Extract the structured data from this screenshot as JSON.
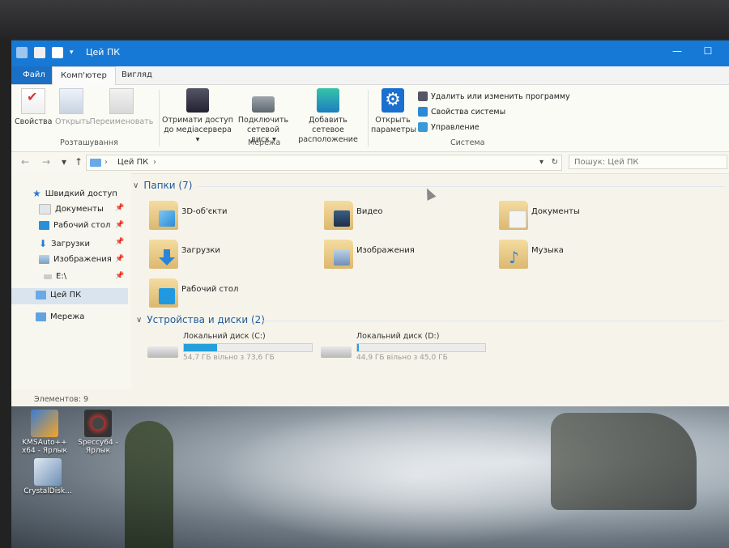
{
  "window": {
    "title": "Цей ПК",
    "minimize_glyph": "—",
    "maximize_glyph": "☐"
  },
  "tabs": [
    {
      "label": "Файл"
    },
    {
      "label": "Комп'ютер"
    },
    {
      "label": "Вигляд"
    }
  ],
  "ribbon": {
    "location": {
      "properties": "Свойства",
      "open": "Открыть",
      "rename": "Переименовать",
      "group_label": "Розташування"
    },
    "network": {
      "media_l1": "Отримати доступ",
      "media_l2": "до медіасервера ▾",
      "map_l1": "Подключить",
      "map_l2": "сетевой диск ▾",
      "add_l1": "Добавить сетевое",
      "add_l2": "расположение",
      "group_label": "Мережа"
    },
    "system": {
      "settings_l1": "Открыть",
      "settings_l2": "параметры",
      "uninstall": "Удалить или изменить программу",
      "sysprops": "Свойства системы",
      "manage": "Управление",
      "group_label": "Система"
    }
  },
  "address": {
    "back": "←",
    "forward": "→",
    "up": "↑",
    "path": "Цей ПК",
    "separator": "›",
    "search_placeholder": "Пошук: Цей ПК"
  },
  "nav": {
    "quick_access": "Швидкий доступ",
    "items": [
      {
        "label": "Документы"
      },
      {
        "label": "Рабочий стол"
      },
      {
        "label": "Загрузки"
      },
      {
        "label": "Изображения"
      },
      {
        "label": "E:\\"
      }
    ],
    "this_pc": "Цей ПК",
    "network": "Мережа"
  },
  "folders_group": "Папки (7)",
  "folders": [
    {
      "name": "3D-об'єкти"
    },
    {
      "name": "Видео"
    },
    {
      "name": "Документы"
    },
    {
      "name": "Загрузки"
    },
    {
      "name": "Изображения"
    },
    {
      "name": "Музыка"
    },
    {
      "name": "Рабочий стол"
    }
  ],
  "drives_group": "Устройства и диски (2)",
  "drives": [
    {
      "name": "Локальний диск (C:)",
      "free": "54,7 ГБ вільно з 73,6 ГБ",
      "used_fraction": 0.26
    },
    {
      "name": "Локальний диск (D:)",
      "free": "44,9 ГБ вільно з 45,0 ГБ",
      "used_fraction": 0.01
    }
  ],
  "status": "Элементов: 9",
  "desktop_icons": [
    {
      "label": "KMSAuto++ x64 - Ярлык"
    },
    {
      "label": "Speccy64 - Ярлык"
    },
    {
      "label": "CrystalDisk..."
    }
  ],
  "colors": {
    "titlebar": "#1779d6",
    "accent": "#26a0da",
    "group_text": "#1e5a9e"
  }
}
